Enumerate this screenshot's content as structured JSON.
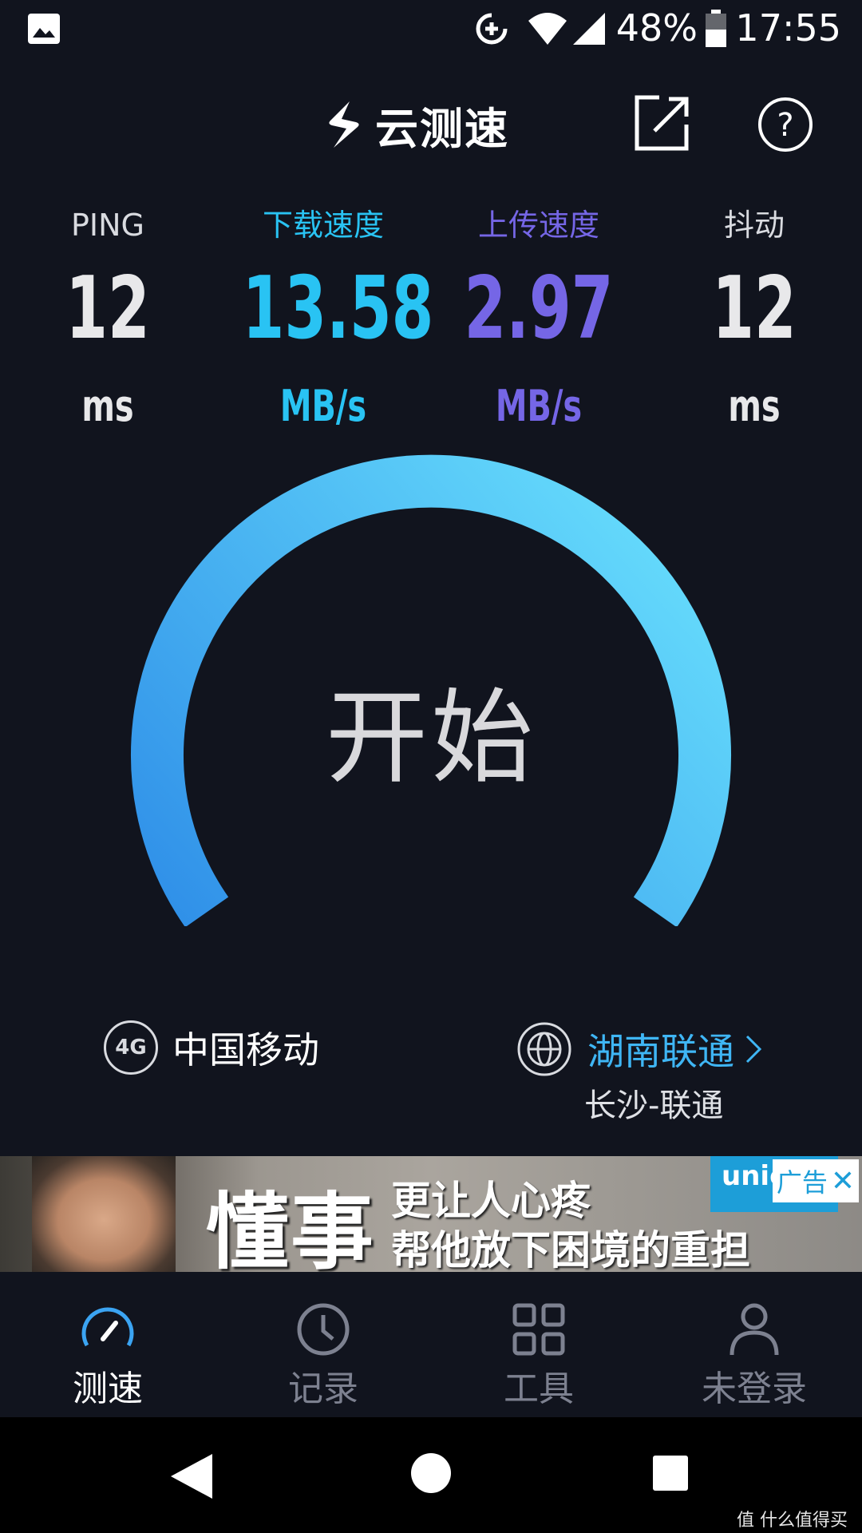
{
  "status_bar": {
    "battery_percent": "48%",
    "time": "17:55"
  },
  "header": {
    "logo_text": "云测速"
  },
  "metrics": {
    "ping": {
      "label": "PING",
      "value": "12",
      "unit": "ms"
    },
    "download": {
      "label": "下载速度",
      "value": "13.58",
      "unit": "MB/s"
    },
    "upload": {
      "label": "上传速度",
      "value": "2.97",
      "unit": "MB/s"
    },
    "jitter": {
      "label": "抖动",
      "value": "12",
      "unit": "ms"
    }
  },
  "gauge": {
    "start_label": "开始"
  },
  "network": {
    "type_badge": "4G",
    "carrier": "中国移动",
    "server_name": "湖南联通",
    "server_location": "长沙-联通"
  },
  "ad": {
    "title": "懂事",
    "line1": "更让人心疼",
    "line2": "帮他放下困境的重担",
    "brand_text": "unic",
    "badge_label": "广告",
    "close_glyph": "✕"
  },
  "tabs": [
    {
      "label": "测速"
    },
    {
      "label": "记录"
    },
    {
      "label": "工具"
    },
    {
      "label": "未登录"
    }
  ],
  "watermark": "值 什么值得买",
  "colors": {
    "background": "#11141e",
    "download": "#29c3f3",
    "upload": "#7566e6",
    "gauge_start": "#2f8fe8",
    "gauge_end": "#63d8fb"
  }
}
